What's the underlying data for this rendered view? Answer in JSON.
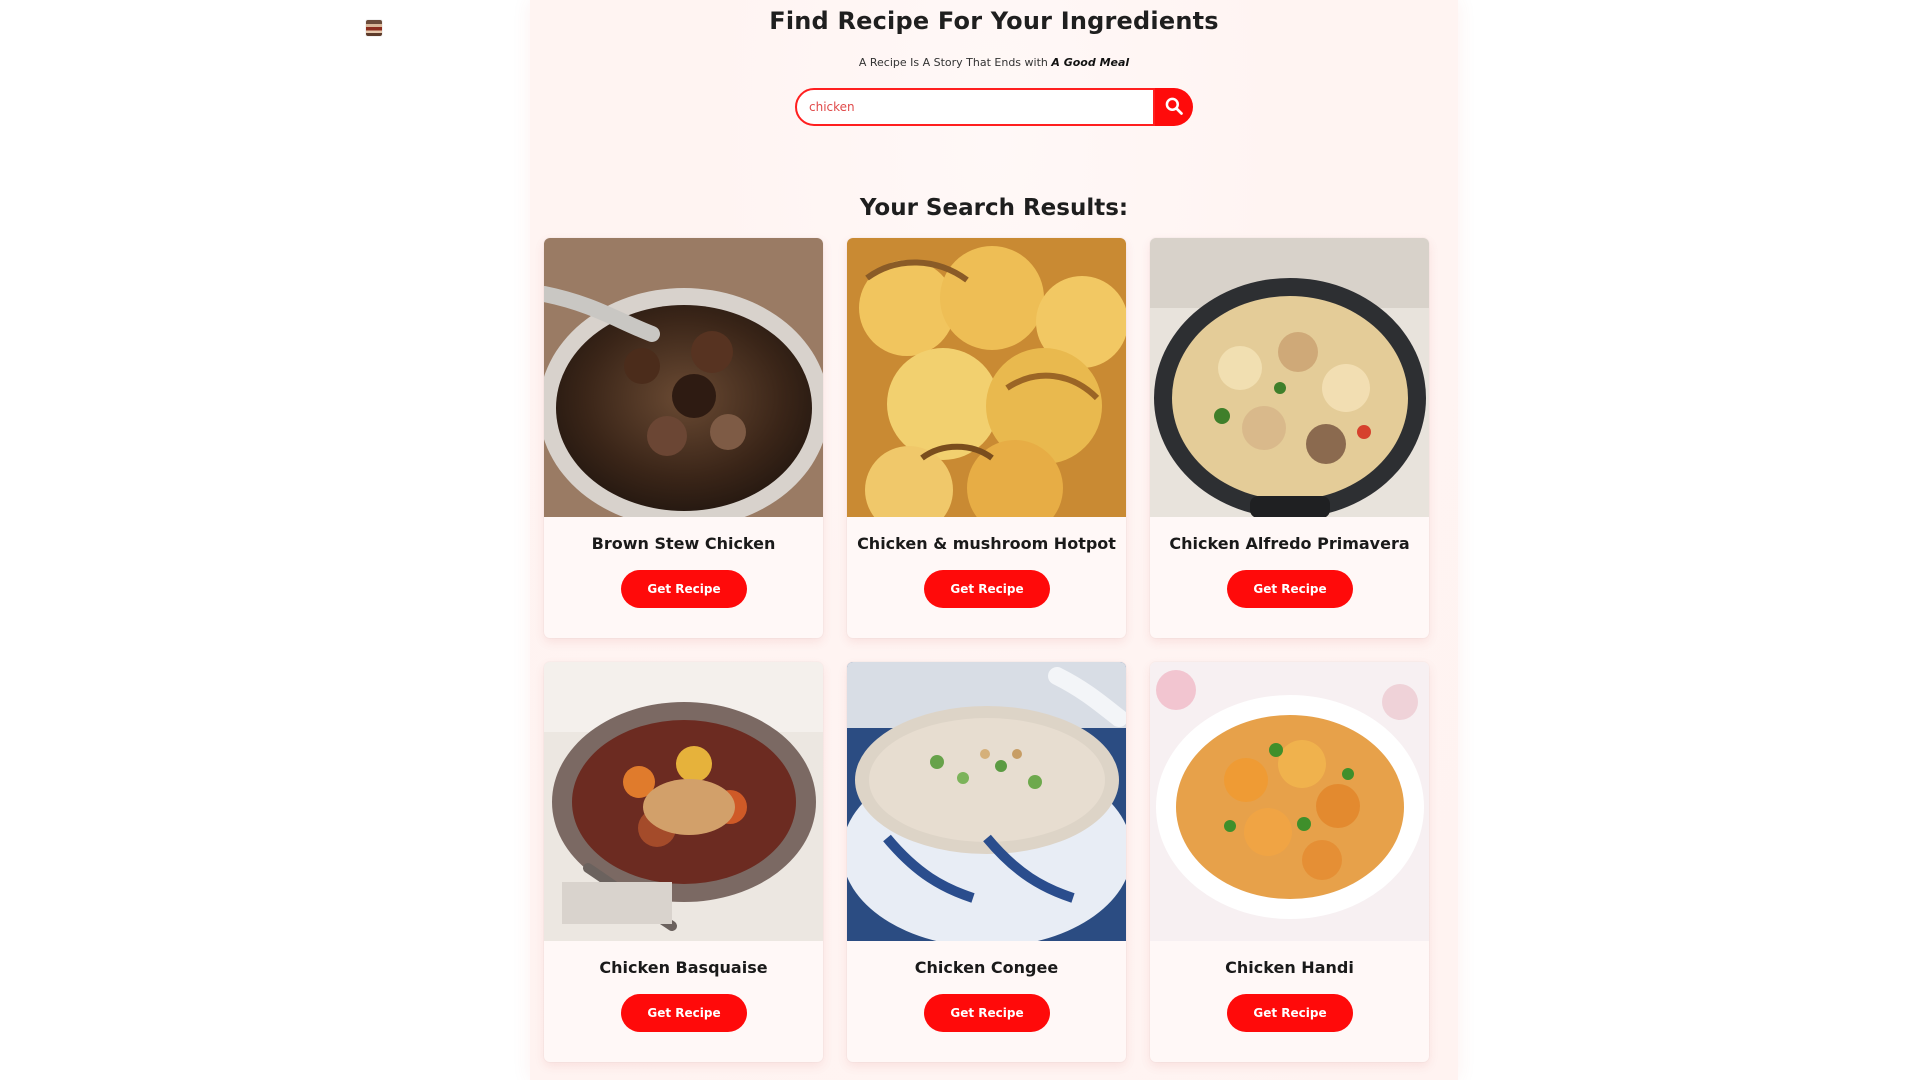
{
  "hero": {
    "title": "Find Recipe For Your Ingredients",
    "tagline_plain": "A Recipe Is A Story That Ends with",
    "tagline_emphasis": "A Good Meal"
  },
  "search": {
    "value": "chicken",
    "placeholder": ""
  },
  "results": {
    "heading": "Your Search Results:",
    "button_label": "Get Recipe",
    "items": [
      {
        "name": "Brown Stew Chicken"
      },
      {
        "name": "Chicken & mushroom Hotpot"
      },
      {
        "name": "Chicken Alfredo Primavera"
      },
      {
        "name": "Chicken Basquaise"
      },
      {
        "name": "Chicken Congee"
      },
      {
        "name": "Chicken Handi"
      }
    ]
  },
  "icons": {
    "logo": "logo-icon",
    "search": "search-icon"
  },
  "colors": {
    "accent": "#ff0b0b"
  }
}
